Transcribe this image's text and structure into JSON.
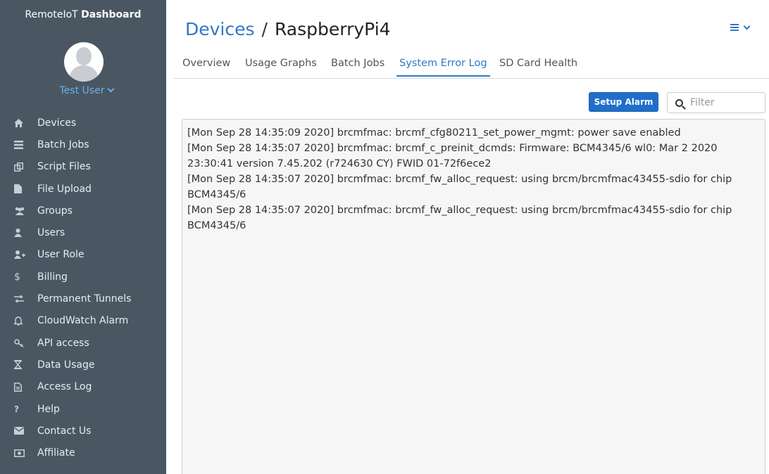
{
  "sidebar": {
    "brand_prefix": "RemoteIoT",
    "brand_bold": "Dashboard",
    "user_name": "Test User",
    "items": [
      {
        "label": "Devices",
        "icon": "home-icon"
      },
      {
        "label": "Batch Jobs",
        "icon": "list-icon"
      },
      {
        "label": "Script Files",
        "icon": "files-icon"
      },
      {
        "label": "File Upload",
        "icon": "file-icon"
      },
      {
        "label": "Groups",
        "icon": "users-icon"
      },
      {
        "label": "Users",
        "icon": "user-icon"
      },
      {
        "label": "User Role",
        "icon": "user-plus-icon"
      },
      {
        "label": "Billing",
        "icon": "dollar-icon"
      },
      {
        "label": "Permanent Tunnels",
        "icon": "exchange-icon"
      },
      {
        "label": "CloudWatch Alarm",
        "icon": "bell-icon"
      },
      {
        "label": "API access",
        "icon": "key-icon"
      },
      {
        "label": "Data Usage",
        "icon": "hourglass-icon"
      },
      {
        "label": "Access Log",
        "icon": "document-icon"
      },
      {
        "label": "Help",
        "icon": "question-icon"
      },
      {
        "label": "Contact Us",
        "icon": "envelope-icon"
      },
      {
        "label": "Affiliate",
        "icon": "money-icon"
      }
    ]
  },
  "header": {
    "breadcrumb_root": "Devices",
    "separator": "/",
    "device_name": "RaspberryPi4"
  },
  "tabs": [
    {
      "label": "Overview",
      "active": false
    },
    {
      "label": "Usage Graphs",
      "active": false
    },
    {
      "label": "Batch Jobs",
      "active": false
    },
    {
      "label": "System Error Log",
      "active": true
    },
    {
      "label": "SD Card Health",
      "active": false
    }
  ],
  "toolbar": {
    "alarm_label": "Setup Alarm",
    "filter_placeholder": "Filter",
    "filter_value": ""
  },
  "log": [
    "[Mon Sep 28 14:35:09 2020] brcmfmac: brcmf_cfg80211_set_power_mgmt: power save enabled",
    "[Mon Sep 28 14:35:07 2020] brcmfmac: brcmf_c_preinit_dcmds: Firmware: BCM4345/6 wl0: Mar  2 2020 23:30:41 version 7.45.202 (r724630 CY) FWID 01-72f6ece2",
    "[Mon Sep 28 14:35:07 2020] brcmfmac: brcmf_fw_alloc_request: using brcm/brcmfmac43455-sdio for chip BCM4345/6",
    "[Mon Sep 28 14:35:07 2020] brcmfmac: brcmf_fw_alloc_request: using brcm/brcmfmac43455-sdio for chip BCM4345/6"
  ],
  "colors": {
    "sidebar_bg": "#4a5763",
    "accent": "#3178c6",
    "button": "#1f6fc9"
  }
}
